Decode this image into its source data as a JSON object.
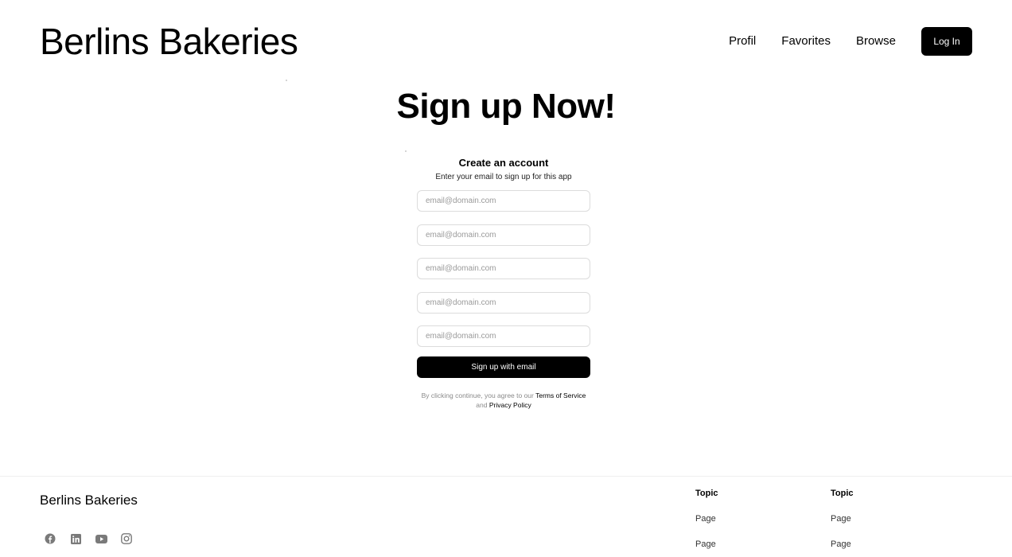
{
  "header": {
    "brand": "Berlins Bakeries",
    "nav": [
      "Profil",
      "Favorites",
      "Browse"
    ],
    "login_label": "Log In"
  },
  "hero": {
    "title": "Sign up Now!"
  },
  "form": {
    "title": "Create an account",
    "subtitle": "Enter your email to sign up for this app",
    "placeholders": [
      "email@domain.com",
      "email@domain.com",
      "email@domain.com",
      "email@domain.com",
      "email@domain.com"
    ],
    "submit_label": "Sign up with email",
    "legal_prefix": "By clicking continue, you agree to our",
    "terms_label": "Terms of Service",
    "legal_and": "and",
    "privacy_label": "Privacy Policy"
  },
  "footer": {
    "brand": "Berlins Bakeries",
    "socials": [
      "facebook-icon",
      "linkedin-icon",
      "youtube-icon",
      "instagram-icon"
    ],
    "columns": [
      {
        "topic": "Topic",
        "pages": [
          "Page",
          "Page"
        ]
      },
      {
        "topic": "Topic",
        "pages": [
          "Page",
          "Page"
        ]
      }
    ]
  },
  "colors": {
    "accent": "#000000",
    "border": "#dcdcdc",
    "muted": "#8a8a8a"
  }
}
